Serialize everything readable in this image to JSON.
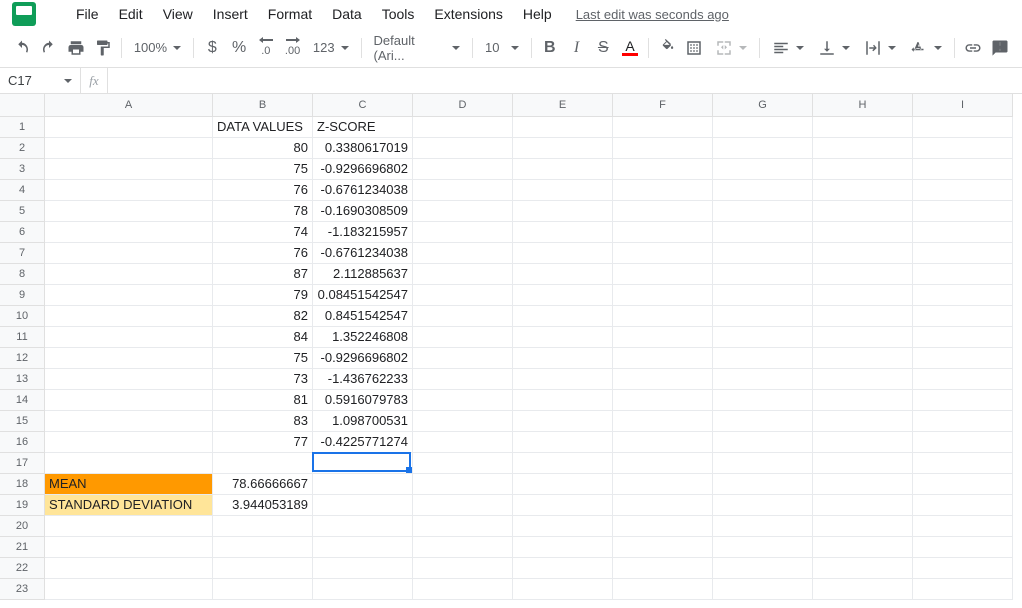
{
  "menu": {
    "file": "File",
    "edit": "Edit",
    "view": "View",
    "insert": "Insert",
    "format": "Format",
    "data": "Data",
    "tools": "Tools",
    "extensions": "Extensions",
    "help": "Help",
    "last_edit": "Last edit was seconds ago"
  },
  "toolbar": {
    "zoom": "100%",
    "currency": "$",
    "percent": "%",
    "dec_dec": ".0",
    "inc_dec": ".00",
    "more_formats": "123",
    "font": "Default (Ari...",
    "font_size": "10",
    "bold": "B",
    "italic": "I",
    "strike": "S",
    "textcolor": "A"
  },
  "namebox": "C17",
  "fx": "fx",
  "columns": [
    "A",
    "B",
    "C",
    "D",
    "E",
    "F",
    "G",
    "H",
    "I"
  ],
  "rows_count": 23,
  "sheet": {
    "B1": "DATA VALUES",
    "C1": "Z-SCORE",
    "B2": "80",
    "C2": "0.3380617019",
    "B3": "75",
    "C3": "-0.9296696802",
    "B4": "76",
    "C4": "-0.6761234038",
    "B5": "78",
    "C5": "-0.1690308509",
    "B6": "74",
    "C6": "-1.183215957",
    "B7": "76",
    "C7": "-0.6761234038",
    "B8": "87",
    "C8": "2.112885637",
    "B9": "79",
    "C9": "0.08451542547",
    "B10": "82",
    "C10": "0.8451542547",
    "B11": "84",
    "C11": "1.352246808",
    "B12": "75",
    "C12": "-0.9296696802",
    "B13": "73",
    "C13": "-1.436762233",
    "B14": "81",
    "C14": "0.5916079783",
    "B15": "83",
    "C15": "1.098700531",
    "B16": "77",
    "C16": "-0.4225771274",
    "A18": "MEAN",
    "B18": "78.66666667",
    "A19": "STANDARD DEVIATION",
    "B19": "3.944053189"
  },
  "selected_cell": "C17"
}
